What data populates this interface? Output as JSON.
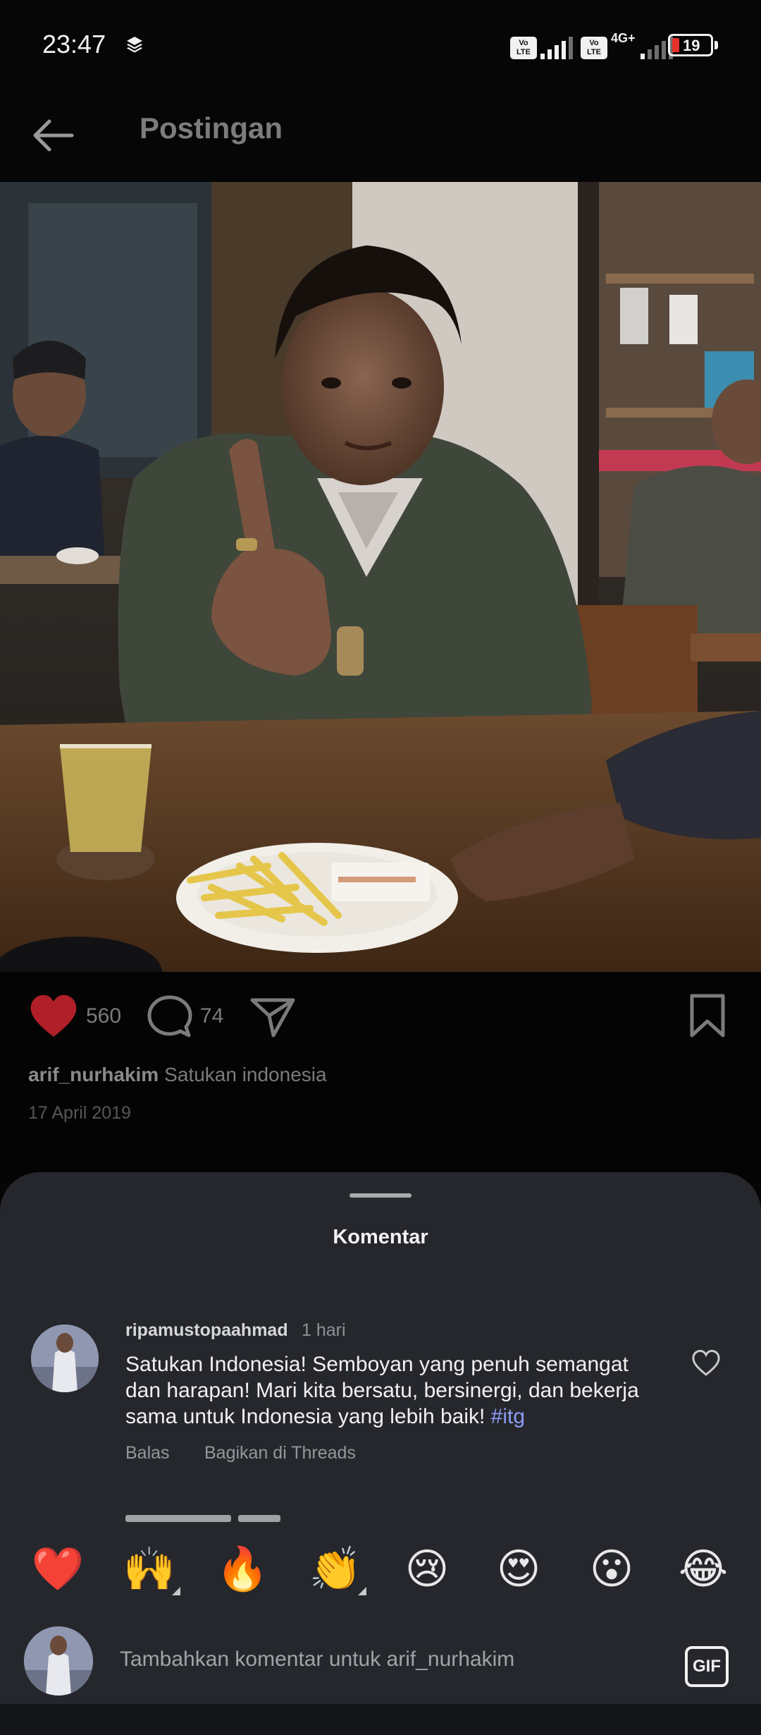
{
  "status_bar": {
    "time": "23:47",
    "sim1_label": "Vo\nLTE",
    "sim2_label": "Vo\nLTE",
    "network": "4G+",
    "battery_level": "19",
    "battery_fraction": 0.19
  },
  "header": {
    "title": "Postingan",
    "back_icon": "arrow-left-icon"
  },
  "post": {
    "likes": "560",
    "comments": "74",
    "username": "arif_nurhakim",
    "caption": "Satukan indonesia",
    "date": "17 April 2019",
    "liked": true
  },
  "comments_sheet": {
    "title": "Komentar",
    "comment": {
      "username": "ripamustopaahmad",
      "time": "1 hari",
      "text": "Satukan Indonesia!  Semboyan yang penuh semangat dan harapan! Mari kita bersatu, bersinergi, dan bekerja sama untuk Indonesia yang lebih baik! ",
      "hashtag": "#itg",
      "reply_label": "Balas",
      "share_label": "Bagikan di Threads"
    },
    "emojis": [
      "❤️",
      "🙌",
      "🔥",
      "👏",
      "😢",
      "😍",
      "😮",
      "😂"
    ],
    "composer_placeholder": "Tambahkan komentar untuk arif_nurhakim",
    "gif_label": "GIF"
  },
  "colors": {
    "background": "#060606",
    "sheet": "#25272c",
    "like_red": "#d8232e",
    "hashtag": "#8e9cf4"
  }
}
